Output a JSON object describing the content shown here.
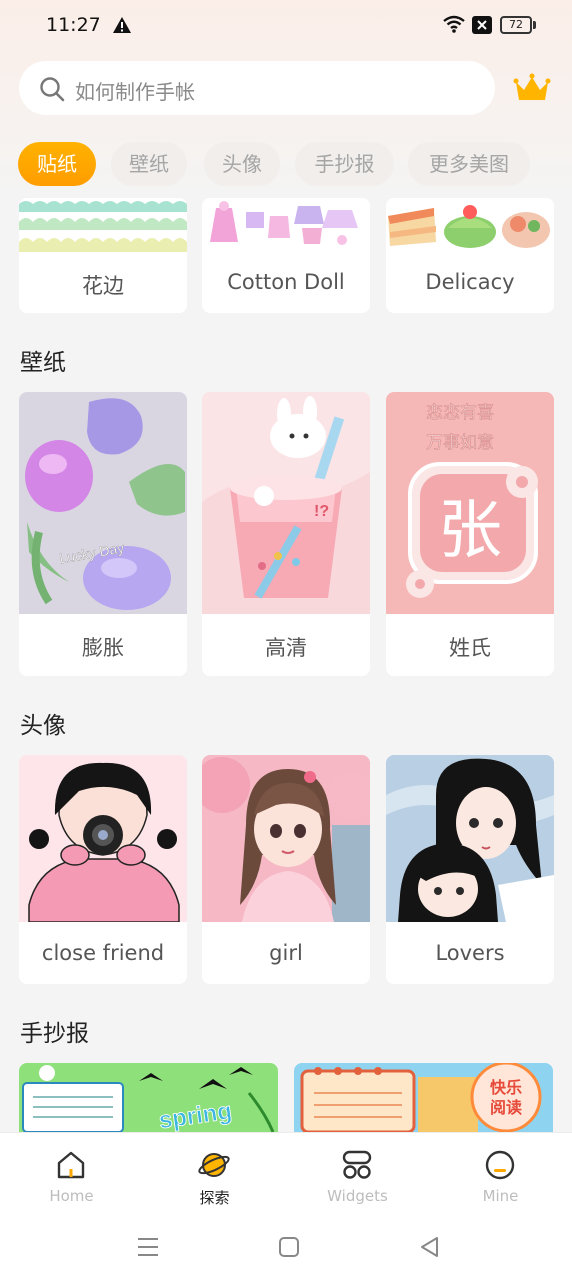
{
  "status_bar": {
    "time": "11:27",
    "battery": "72"
  },
  "search": {
    "placeholder": "如何制作手帐"
  },
  "tabs": [
    {
      "label": "贴纸",
      "active": true
    },
    {
      "label": "壁纸",
      "active": false
    },
    {
      "label": "头像",
      "active": false
    },
    {
      "label": "手抄报",
      "active": false
    },
    {
      "label": "更多美图",
      "active": false
    }
  ],
  "stickers": [
    {
      "label": "花边"
    },
    {
      "label": "Cotton Doll"
    },
    {
      "label": "Delicacy"
    }
  ],
  "wallpaper": {
    "title": "壁纸",
    "items": [
      {
        "label": "膨胀"
      },
      {
        "label": "高清"
      },
      {
        "label": "姓氏",
        "image_text": [
          "恋恋有喜",
          "万事如意",
          "张"
        ]
      }
    ]
  },
  "avatar": {
    "title": "头像",
    "items": [
      {
        "label": "close friend"
      },
      {
        "label": "girl"
      },
      {
        "label": "Lovers"
      }
    ]
  },
  "handcopy": {
    "title": "手抄报",
    "image_text": [
      "spring",
      "快乐",
      "阅读"
    ]
  },
  "bottom_nav": [
    {
      "label": "Home",
      "icon": "home-icon"
    },
    {
      "label": "探索",
      "icon": "explore-planet-icon",
      "active": true
    },
    {
      "label": "Widgets",
      "icon": "widgets-icon"
    },
    {
      "label": "Mine",
      "icon": "mine-icon"
    }
  ],
  "colors": {
    "accent": "#ffa800",
    "crown": "#ffb400"
  }
}
